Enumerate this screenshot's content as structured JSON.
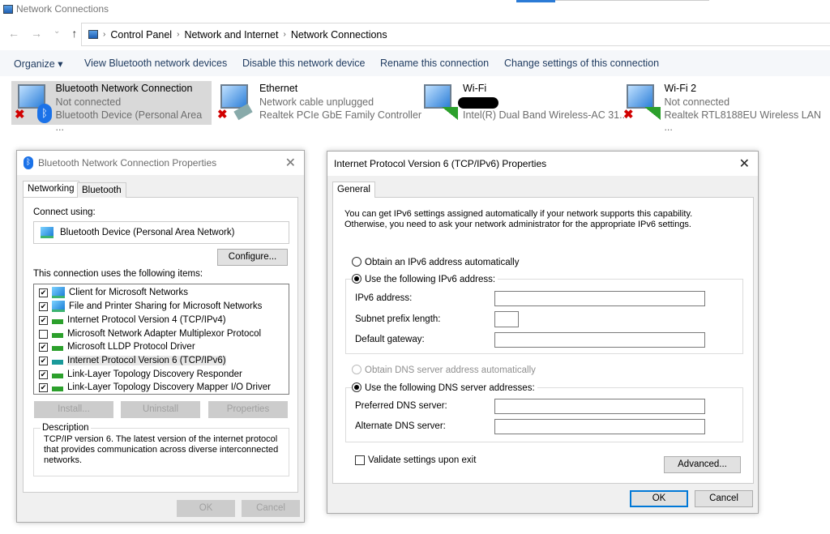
{
  "window": {
    "title": "Network Connections"
  },
  "nav": {
    "back": "←",
    "forward": "→",
    "recent": "⌄",
    "up": "↑"
  },
  "breadcrumb": [
    "Control Panel",
    "Network and Internet",
    "Network Connections"
  ],
  "toolbar": {
    "organize": "Organize ▾",
    "view_bt": "View Bluetooth network devices",
    "disable": "Disable this network device",
    "rename": "Rename this connection",
    "change": "Change settings of this connection"
  },
  "connections": [
    {
      "name": "Bluetooth Network Connection",
      "status": "Not connected",
      "device": "Bluetooth Device (Personal Area ...",
      "icon": "bluetooth-icon",
      "selected": true
    },
    {
      "name": "Ethernet",
      "status": "Network cable unplugged",
      "device": "Realtek PCIe GbE Family Controller",
      "icon": "ethernet-icon"
    },
    {
      "name": "Wi-Fi",
      "status": "",
      "device": "Intel(R) Dual Band Wireless-AC 31...",
      "icon": "wifi-icon"
    },
    {
      "name": "Wi-Fi 2",
      "status": "Not connected",
      "device": "Realtek RTL8188EU Wireless LAN ...",
      "icon": "wifi-icon"
    }
  ],
  "bt_dialog": {
    "title": "Bluetooth Network Connection Properties",
    "tabs": [
      "Networking",
      "Bluetooth"
    ],
    "connect_using_label": "Connect using:",
    "adapter": "Bluetooth Device (Personal Area Network)",
    "configure": "Configure...",
    "items_label": "This connection uses the following items:",
    "items": [
      {
        "label": "Client for Microsoft Networks",
        "checked": true
      },
      {
        "label": "File and Printer Sharing for Microsoft Networks",
        "checked": true
      },
      {
        "label": "Internet Protocol Version 4 (TCP/IPv4)",
        "checked": true
      },
      {
        "label": "Microsoft Network Adapter Multiplexor Protocol",
        "checked": false
      },
      {
        "label": "Microsoft LLDP Protocol Driver",
        "checked": true
      },
      {
        "label": "Internet Protocol Version 6 (TCP/IPv6)",
        "checked": true,
        "selected": true
      },
      {
        "label": "Link-Layer Topology Discovery Responder",
        "checked": true
      },
      {
        "label": "Link-Layer Topology Discovery Mapper I/O Driver",
        "checked": true
      }
    ],
    "install": "Install...",
    "uninstall": "Uninstall",
    "properties": "Properties",
    "description_label": "Description",
    "description": "TCP/IP version 6. The latest version of the internet protocol that provides communication across diverse interconnected networks.",
    "ok": "OK",
    "cancel": "Cancel"
  },
  "ipv6_dialog": {
    "title": "Internet Protocol Version 6 (TCP/IPv6) Properties",
    "tab": "General",
    "intro": "You can get IPv6 settings assigned automatically if your network supports this capability. Otherwise, you need to ask your network administrator for the appropriate IPv6 settings.",
    "obtain_auto": "Obtain an IPv6 address automatically",
    "use_following": "Use the following IPv6 address:",
    "ipv6_address": "IPv6 address:",
    "ipv6_value": "",
    "subnet": "Subnet prefix length:",
    "subnet_value": "",
    "gateway": "Default gateway:",
    "gateway_value": "",
    "dns_auto": "Obtain DNS server address automatically",
    "dns_use": "Use the following DNS server addresses:",
    "preferred": "Preferred DNS server:",
    "preferred_value": "",
    "alternate": "Alternate DNS server:",
    "alternate_value": "",
    "validate": "Validate settings upon exit",
    "advanced": "Advanced...",
    "ok": "OK",
    "cancel": "Cancel"
  }
}
